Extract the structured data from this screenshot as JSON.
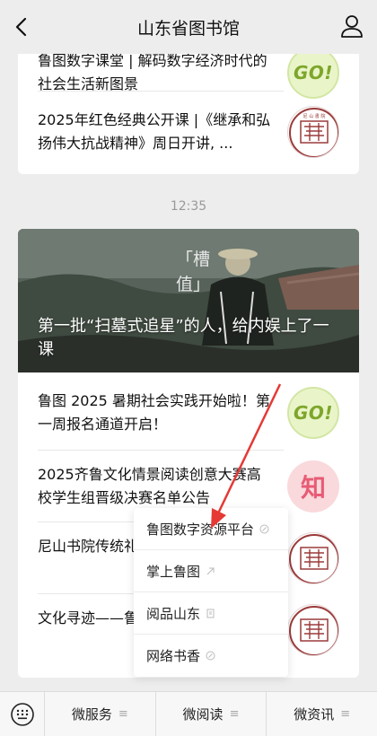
{
  "header": {
    "title": "山东省图书馆",
    "back_icon": "chevron-left-icon",
    "user_icon": "user-icon"
  },
  "top_card": {
    "items": [
      {
        "text": "鲁图数字课堂 | 解码数字经济时代的社会生活新图景",
        "thumb": "go"
      },
      {
        "text": "2025年红色经典公开课 |《继承和弘扬伟大抗战精神》周日开讲, ...",
        "thumb": "seal"
      }
    ]
  },
  "timestamp": "12:35",
  "main_card": {
    "hero_title": "第一批“扫墓式追星”的人，给内娱上了一课",
    "hero_overlay": "「槽\n值」",
    "items": [
      {
        "text": "鲁图 2025 暑期社会实践开始啦！第一周报名通道开启！",
        "thumb": "go"
      },
      {
        "text": "2025齐鲁文化情景阅读创意大赛高校学生组晋级决赛名单公告",
        "thumb": "zhi"
      },
      {
        "text": "尼山书院传统礼放！",
        "thumb": "seal"
      },
      {
        "text": "文化寻迹——鲁院",
        "thumb": "seal"
      }
    ]
  },
  "thumb_labels": {
    "go": "GO!",
    "zhi": "知",
    "seal": "尼山書院"
  },
  "popup_menu": {
    "items": [
      {
        "label": "鲁图数字资源平台",
        "icon": "link-icon"
      },
      {
        "label": "掌上鲁图",
        "icon": "link-icon"
      },
      {
        "label": "阅品山东",
        "icon": "page-icon"
      },
      {
        "label": "网络书香",
        "icon": "link-icon"
      }
    ]
  },
  "bottom_bar": {
    "keyboard_icon": "keyboard-icon",
    "tabs": [
      {
        "label": "微服务"
      },
      {
        "label": "微阅读"
      },
      {
        "label": "微资讯"
      }
    ]
  },
  "colors": {
    "background": "#ededed",
    "card": "#ffffff",
    "arrow": "#e53935",
    "go_green": "#7ea62b",
    "zhi_pink": "#e85b75"
  }
}
